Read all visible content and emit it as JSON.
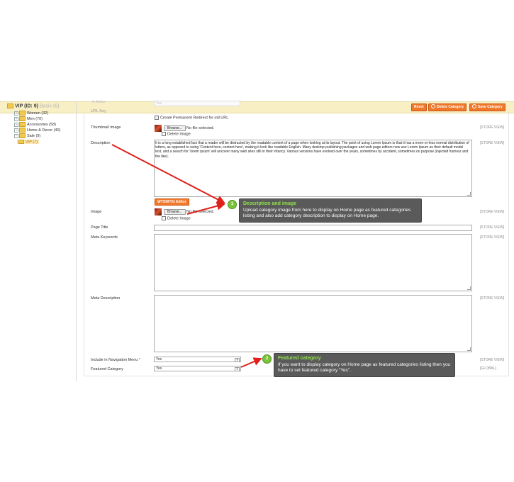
{
  "header": {
    "title": "VIP (ID: 9)",
    "title_ghost": "Basic (6)",
    "buttons": {
      "reset": "Reset",
      "delete": "Delete Category",
      "save": "Save Category"
    }
  },
  "tree": {
    "items": [
      {
        "label": "Women (32)"
      },
      {
        "label": "Men (70)"
      },
      {
        "label": "Accessories (58)"
      },
      {
        "label": "Home & Decor (40)"
      },
      {
        "label": "Sale (9)"
      }
    ],
    "selected": "VIP (7)"
  },
  "form": {
    "ghost_row_label": "Is Active",
    "ghost_row_value": "Yes",
    "ghost_url_label": "URL Key",
    "redirect_label": "Create Permanent Redirect for old URL",
    "thumbnail": {
      "label": "Thumbnail Image",
      "browse": "Browse...",
      "no_file": "No file selected.",
      "delete": "Delete Image",
      "scope": "[STORE VIEW]"
    },
    "description": {
      "label": "Description",
      "text": "It is a long established fact that a reader will be distracted by the readable content of a page when looking at its layout. The point of using Lorem Ipsum is that it has a more-or-less normal distribution of letters, as opposed to using 'Content here, content here', making it look like readable English. Many desktop publishing packages and web page editors now use Lorem Ipsum as their default model text, and a search for 'lorem ipsum' will uncover many web sites still in their infancy. Various versions have evolved over the years, sometimes by accident, sometimes on purpose (injected humour and the like).",
      "wysiwyg": "WYSIWYG Editor",
      "scope": "[STORE VIEW]"
    },
    "image": {
      "label": "Image",
      "browse": "Browse...",
      "no_file": "No file selected.",
      "delete": "Delete Image",
      "scope": "[STORE VIEW]"
    },
    "page_title": {
      "label": "Page Title",
      "scope": "[STORE VIEW]"
    },
    "meta_keywords": {
      "label": "Meta Keywords",
      "scope": "[STORE VIEW]"
    },
    "meta_description": {
      "label": "Meta Description",
      "scope": "[STORE VIEW]"
    },
    "include_nav": {
      "label": "Include in Navigation Menu",
      "required": "*",
      "value": "Yes",
      "scope": "[STORE VIEW]"
    },
    "featured": {
      "label": "Featured Category",
      "value": "Yes",
      "scope": "[GLOBAL]"
    }
  },
  "callouts": [
    {
      "num": "1",
      "title": "Description and image",
      "body": "Upload category image from here to display on Home page as featured categories listing and also add category description to display on Home page."
    },
    {
      "num": "2",
      "title": "Featured category",
      "body": "If you want to display category on Home page as featured categories listing then you have to set featured category \"Yes\"."
    }
  ],
  "colors": {
    "header_bg": "#f8efc5",
    "accent_button": "#f1782a",
    "callout_bg": "#5a5a5a",
    "callout_title": "#8ee04a",
    "arrow": "#e0201b"
  }
}
